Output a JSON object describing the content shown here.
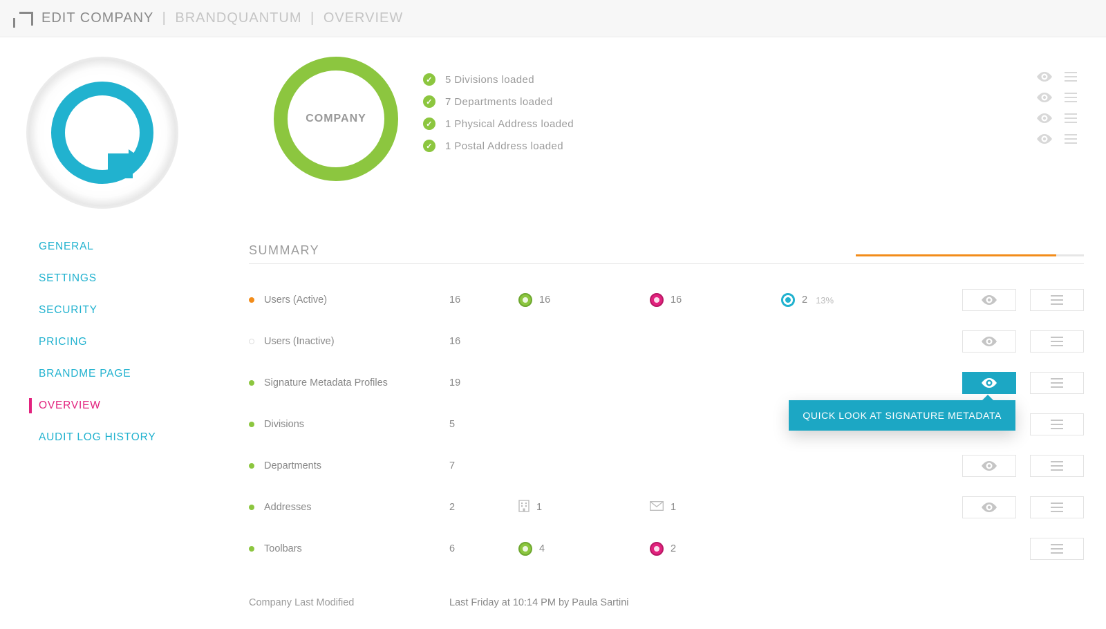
{
  "header": {
    "main": "EDIT COMPANY",
    "company": "BRANDQUANTUM",
    "section": "OVERVIEW"
  },
  "nav": [
    {
      "label": "GENERAL",
      "active": false
    },
    {
      "label": "SETTINGS",
      "active": false
    },
    {
      "label": "SECURITY",
      "active": false
    },
    {
      "label": "PRICING",
      "active": false
    },
    {
      "label": "BRANDME PAGE",
      "active": false
    },
    {
      "label": "OVERVIEW",
      "active": true
    },
    {
      "label": "AUDIT LOG HISTORY",
      "active": false
    }
  ],
  "company_ring": "COMPANY",
  "loaded": [
    "5 Divisions loaded",
    "7 Departments loaded",
    "1 Physical Address loaded",
    "1 Postal Address loaded"
  ],
  "summary": {
    "title": "SUMMARY",
    "progress_pct": 88,
    "rows": [
      {
        "bullet": "b-orange",
        "label": "Users (Active)",
        "v1": "16",
        "v2": "16",
        "v2_badge": "green",
        "v3": "16",
        "v3_badge": "pink",
        "v4": "2",
        "v4_badge": "cyan",
        "pct": "13%",
        "eye": true,
        "menu": true,
        "eye_active": false
      },
      {
        "bullet": "b-empty",
        "label": "Users (Inactive)",
        "v1": "16",
        "eye": true,
        "menu": true
      },
      {
        "bullet": "b-green",
        "label": "Signature Metadata Profiles",
        "v1": "19",
        "eye": true,
        "menu": true,
        "eye_active": true,
        "tooltip": "QUICK LOOK AT SIGNATURE METADATA"
      },
      {
        "bullet": "b-green",
        "label": "Divisions",
        "v1": "5",
        "menu": true
      },
      {
        "bullet": "b-green",
        "label": "Departments",
        "v1": "7",
        "eye": true,
        "menu": true
      },
      {
        "bullet": "b-green",
        "label": "Addresses",
        "v1": "2",
        "v2": "1",
        "v2_icon": "building",
        "v3": "1",
        "v3_icon": "mail",
        "eye": true,
        "menu": true
      },
      {
        "bullet": "b-green",
        "label": "Toolbars",
        "v1": "6",
        "v2": "4",
        "v2_badge": "green",
        "v3": "2",
        "v3_badge": "pink",
        "menu": true
      }
    ],
    "last_modified_label": "Company Last Modified",
    "last_modified_value": "Last Friday at 10:14 PM by Paula Sartini"
  }
}
